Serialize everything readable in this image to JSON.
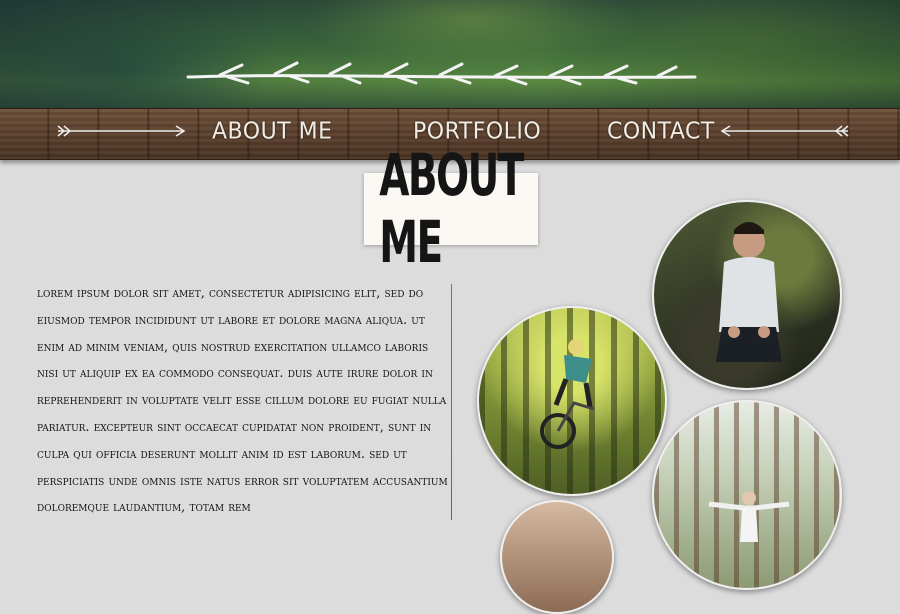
{
  "nav": {
    "about": "ABOUT ME",
    "portfolio": "PORTFOLIO",
    "contact": "CONTACT"
  },
  "page": {
    "title": "ABOUT ME"
  },
  "body_text": "Lorem ipsum dolor sit amet, consectetur adipisicing elit, sed do eiusmod tempor incididunt ut labore et dolore magna aliqua. Ut enim ad minim veniam, quis nostrud exercitation ullamco laboris nisi ut aliquip ex ea commodo consequat. Duis aute irure dolor in reprehenderit in voluptate velit esse cillum dolore eu fugiat nulla pariatur. Excepteur sint occaecat cupidatat non proident, sunt in culpa qui officia deserunt mollit anim id est laborum. Sed ut perspiciatis unde omnis iste natus error sit voluptatem accusantium doloremque laudantium, totam rem",
  "colors": {
    "background": "#dcdcdc",
    "wood": "#5a3f2c",
    "nav_text": "#f1ece4",
    "title_text": "#151515"
  },
  "icons": {
    "left_arrow": "arrow-right-icon",
    "right_arrow": "arrow-left-icon",
    "branch": "branch-ornament-icon"
  }
}
